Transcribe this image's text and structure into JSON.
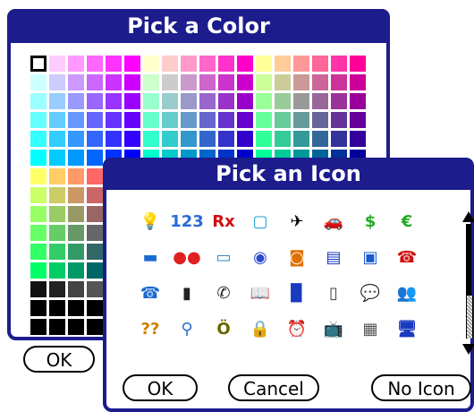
{
  "color_dialog": {
    "title": "Pick a Color",
    "ok_label": "OK",
    "palette": [
      [
        "#ffffff",
        "#ffccff",
        "#ff99ff",
        "#ff66ff",
        "#ff33ff",
        "#ff00ff",
        "#ffffcc",
        "#ffcccc",
        "#ff99cc",
        "#ff66cc",
        "#ff33cc",
        "#ff00cc",
        "#ffff99",
        "#ffcc99",
        "#ff9999",
        "#ff6699",
        "#ff33aa",
        "#ff0099"
      ],
      [
        "#ccffff",
        "#ccccff",
        "#cc99ff",
        "#cc66ff",
        "#cc33ff",
        "#cc00ff",
        "#ccffcc",
        "#cccccc",
        "#cc99cc",
        "#cc66cc",
        "#cc33cc",
        "#cc00cc",
        "#ccff99",
        "#cccc99",
        "#cc9999",
        "#cc6699",
        "#cc3399",
        "#cc0099"
      ],
      [
        "#99ffff",
        "#99ccff",
        "#9999ff",
        "#9966ff",
        "#9933ff",
        "#9900ff",
        "#99ffcc",
        "#99cccc",
        "#9999cc",
        "#9966cc",
        "#9933cc",
        "#9900cc",
        "#99ff99",
        "#99cc99",
        "#999999",
        "#996699",
        "#993399",
        "#990099"
      ],
      [
        "#66ffff",
        "#66ccff",
        "#6699ff",
        "#6666ff",
        "#6633ff",
        "#6600ff",
        "#66ffcc",
        "#66cccc",
        "#6699cc",
        "#6666cc",
        "#6633cc",
        "#6600cc",
        "#66ff99",
        "#66cc99",
        "#669999",
        "#666699",
        "#663399",
        "#660099"
      ],
      [
        "#33ffff",
        "#33ccff",
        "#3399ff",
        "#3366ff",
        "#3333ff",
        "#3300ff",
        "#33ffcc",
        "#33cccc",
        "#3399cc",
        "#3366cc",
        "#3333cc",
        "#3300cc",
        "#33ff99",
        "#33cc99",
        "#339999",
        "#336699",
        "#333399",
        "#330099"
      ],
      [
        "#00ffff",
        "#00ccff",
        "#0099ff",
        "#0066ff",
        "#0033ff",
        "#0000ff",
        "#00ffcc",
        "#00cccc",
        "#0099cc",
        "#0066cc",
        "#0033cc",
        "#0000cc",
        "#00ff99",
        "#00cc99",
        "#009999",
        "#006699",
        "#003399",
        "#000099"
      ],
      [
        "#ffff66",
        "#ffcc66",
        "#ff9966",
        "#ff6666",
        "#ff3366",
        "#ff0066",
        "#ffff33",
        "#ffcc33",
        "#ff9933",
        "#ff6633",
        "#ff3333",
        "#ff0033",
        "#ffff00",
        "#ffcc00",
        "#ff9900",
        "#ff6600",
        "#ff3300",
        "#ff0000"
      ],
      [
        "#ccff66",
        "#cccc66",
        "#cc9966",
        "#cc6666",
        "#cc3366",
        "#cc0066",
        "#ccff33",
        "#cccc33",
        "#cc9933",
        "#cc6633",
        "#cc3333",
        "#cc0033",
        "#ccff00",
        "#cccc00",
        "#cc9900",
        "#cc6600",
        "#cc3300",
        "#cc0000"
      ],
      [
        "#99ff66",
        "#99cc66",
        "#999966",
        "#996666",
        "#993366",
        "#990066",
        "#99ff33",
        "#99cc33",
        "#999933",
        "#996633",
        "#993333",
        "#990033",
        "#99ff00",
        "#99cc00",
        "#999900",
        "#996600",
        "#993300",
        "#990000"
      ],
      [
        "#66ff66",
        "#66cc66",
        "#669966",
        "#666666",
        "#663366",
        "#660066",
        "#66ff33",
        "#66cc33",
        "#669933",
        "#666633",
        "#663333",
        "#660033",
        "#66ff00",
        "#66cc00",
        "#669900",
        "#666600",
        "#663300",
        "#660000"
      ],
      [
        "#33ff66",
        "#33cc66",
        "#339966",
        "#336666",
        "#333366",
        "#330066",
        "#33ff33",
        "#33cc33",
        "#339933",
        "#336633",
        "#333333",
        "#330033",
        "#33ff00",
        "#33cc00",
        "#339900",
        "#336600",
        "#333300",
        "#330000"
      ],
      [
        "#00ff66",
        "#00cc66",
        "#009966",
        "#006666",
        "#003366",
        "#000066",
        "#00ff33",
        "#00cc33",
        "#009933",
        "#006633",
        "#003333",
        "#000033",
        "#00ff00",
        "#00cc00",
        "#009900",
        "#006600",
        "#003300",
        "#000000"
      ],
      [
        "#111111",
        "#222222",
        "#444444",
        "#555555",
        "#777777",
        "#888888",
        "#aaaaaa",
        "#bbbbbb",
        "#dddddd",
        "#eeeeee",
        "#000000",
        "#000000",
        "#000000",
        "#000000",
        "#000000",
        "#000000",
        "#000000",
        "#000000"
      ],
      [
        "#000000",
        "#000000",
        "#000000",
        "#000000",
        "#000000",
        "#000000",
        "#000000",
        "#000000",
        "#000000",
        "#000000",
        "#000000",
        "#000000",
        "#000000",
        "#000000",
        "#000000",
        "#000000",
        "#000000",
        "#000000"
      ],
      [
        "#000000",
        "#000000",
        "#000000",
        "#000000",
        "#000000",
        "#000000",
        "#000000",
        "#000000",
        "#000000",
        "#000000",
        "#000000",
        "#000000",
        "#000000",
        "#000000",
        "#000000",
        "#000000",
        "#000000",
        "#000000"
      ]
    ]
  },
  "icon_dialog": {
    "title": "Pick an Icon",
    "ok_label": "OK",
    "cancel_label": "Cancel",
    "no_icon_label": "No Icon",
    "icons": [
      [
        {
          "name": "lightbulb-icon",
          "glyph": "💡",
          "color": "#e0b000"
        },
        {
          "name": "numbers-icon",
          "glyph": "123",
          "color": "#2a6ad6"
        },
        {
          "name": "rx-icon",
          "glyph": "Rx",
          "color": "#d01010"
        },
        {
          "name": "monitor-icon",
          "glyph": "▢",
          "color": "#1aa0d0"
        },
        {
          "name": "airplane-icon",
          "glyph": "✈",
          "color": "#000000"
        },
        {
          "name": "car-icon",
          "glyph": "🚗",
          "color": "#d01010"
        },
        {
          "name": "dollar-icon",
          "glyph": "$",
          "color": "#22aa22"
        },
        {
          "name": "euro-icon",
          "glyph": "€",
          "color": "#22aa22"
        }
      ],
      [
        {
          "name": "flag-icon",
          "glyph": "▬",
          "color": "#1a6ad0"
        },
        {
          "name": "mastercard-icon",
          "glyph": "●●",
          "color": "#e02020"
        },
        {
          "name": "card-icon",
          "glyph": "▭",
          "color": "#2a8ac0"
        },
        {
          "name": "disc-icon",
          "glyph": "◉",
          "color": "#2a4ad0"
        },
        {
          "name": "sun-icon",
          "glyph": "◙",
          "color": "#e07000"
        },
        {
          "name": "note-icon",
          "glyph": "▤",
          "color": "#1a3ac0"
        },
        {
          "name": "id-card-icon",
          "glyph": "▣",
          "color": "#1a5ad0"
        },
        {
          "name": "phone-red-icon",
          "glyph": "☎",
          "color": "#d01010"
        }
      ],
      [
        {
          "name": "telephone-icon",
          "glyph": "☎",
          "color": "#1a6ad0"
        },
        {
          "name": "cellphone-icon",
          "glyph": "▮",
          "color": "#222222"
        },
        {
          "name": "handset-icon",
          "glyph": "✆",
          "color": "#222222"
        },
        {
          "name": "book-icon",
          "glyph": "📖",
          "color": "#222222"
        },
        {
          "name": "notebook-icon",
          "glyph": "▉",
          "color": "#1a3ac0"
        },
        {
          "name": "document-icon",
          "glyph": "▯",
          "color": "#444444"
        },
        {
          "name": "speech-bubble-icon",
          "glyph": "💬",
          "color": "#222222"
        },
        {
          "name": "people-icon",
          "glyph": "👥",
          "color": "#d08000"
        }
      ],
      [
        {
          "name": "question-icon",
          "glyph": "??",
          "color": "#d08000"
        },
        {
          "name": "search-icon",
          "glyph": "⚲",
          "color": "#2a6ad0"
        },
        {
          "name": "money-bag-icon",
          "glyph": "Ö",
          "color": "#666600"
        },
        {
          "name": "lock-icon",
          "glyph": "🔒",
          "color": "#c0a000"
        },
        {
          "name": "alarm-clock-icon",
          "glyph": "⏰",
          "color": "#c0a000"
        },
        {
          "name": "tv-icon",
          "glyph": "📺",
          "color": "#333333"
        },
        {
          "name": "calculator-icon",
          "glyph": "▦",
          "color": "#555555"
        },
        {
          "name": "computer-icon",
          "glyph": "🖥",
          "color": "#1a3ac0"
        }
      ]
    ]
  }
}
